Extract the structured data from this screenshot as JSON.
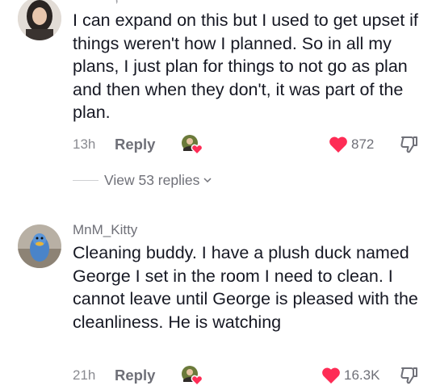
{
  "comments": [
    {
      "username": "",
      "text": "I can expand on this but I used to get upset if things weren't how I planned. So in all my plans, I just plan for things to not go as plan and then when they don't, it was part of the plan.",
      "time": "13h",
      "reply_label": "Reply",
      "likes": "872",
      "view_replies": "View 53 replies"
    },
    {
      "username": "MnM_Kitty",
      "text": "Cleaning buddy. I have a plush duck named George I set in the room I need to clean. I cannot leave until George is pleased with the cleanliness. He is watching",
      "time": "21h",
      "reply_label": "Reply",
      "likes": "16.3K"
    }
  ],
  "colors": {
    "heart": "#fe2c55",
    "secondary_text": "#6f7078",
    "primary_text": "#161823"
  },
  "icons": {
    "like": "heart-icon",
    "dislike": "thumbs-down-icon",
    "creator_like": "creator-liked-badge-icon",
    "expand": "chevron-down-icon"
  }
}
